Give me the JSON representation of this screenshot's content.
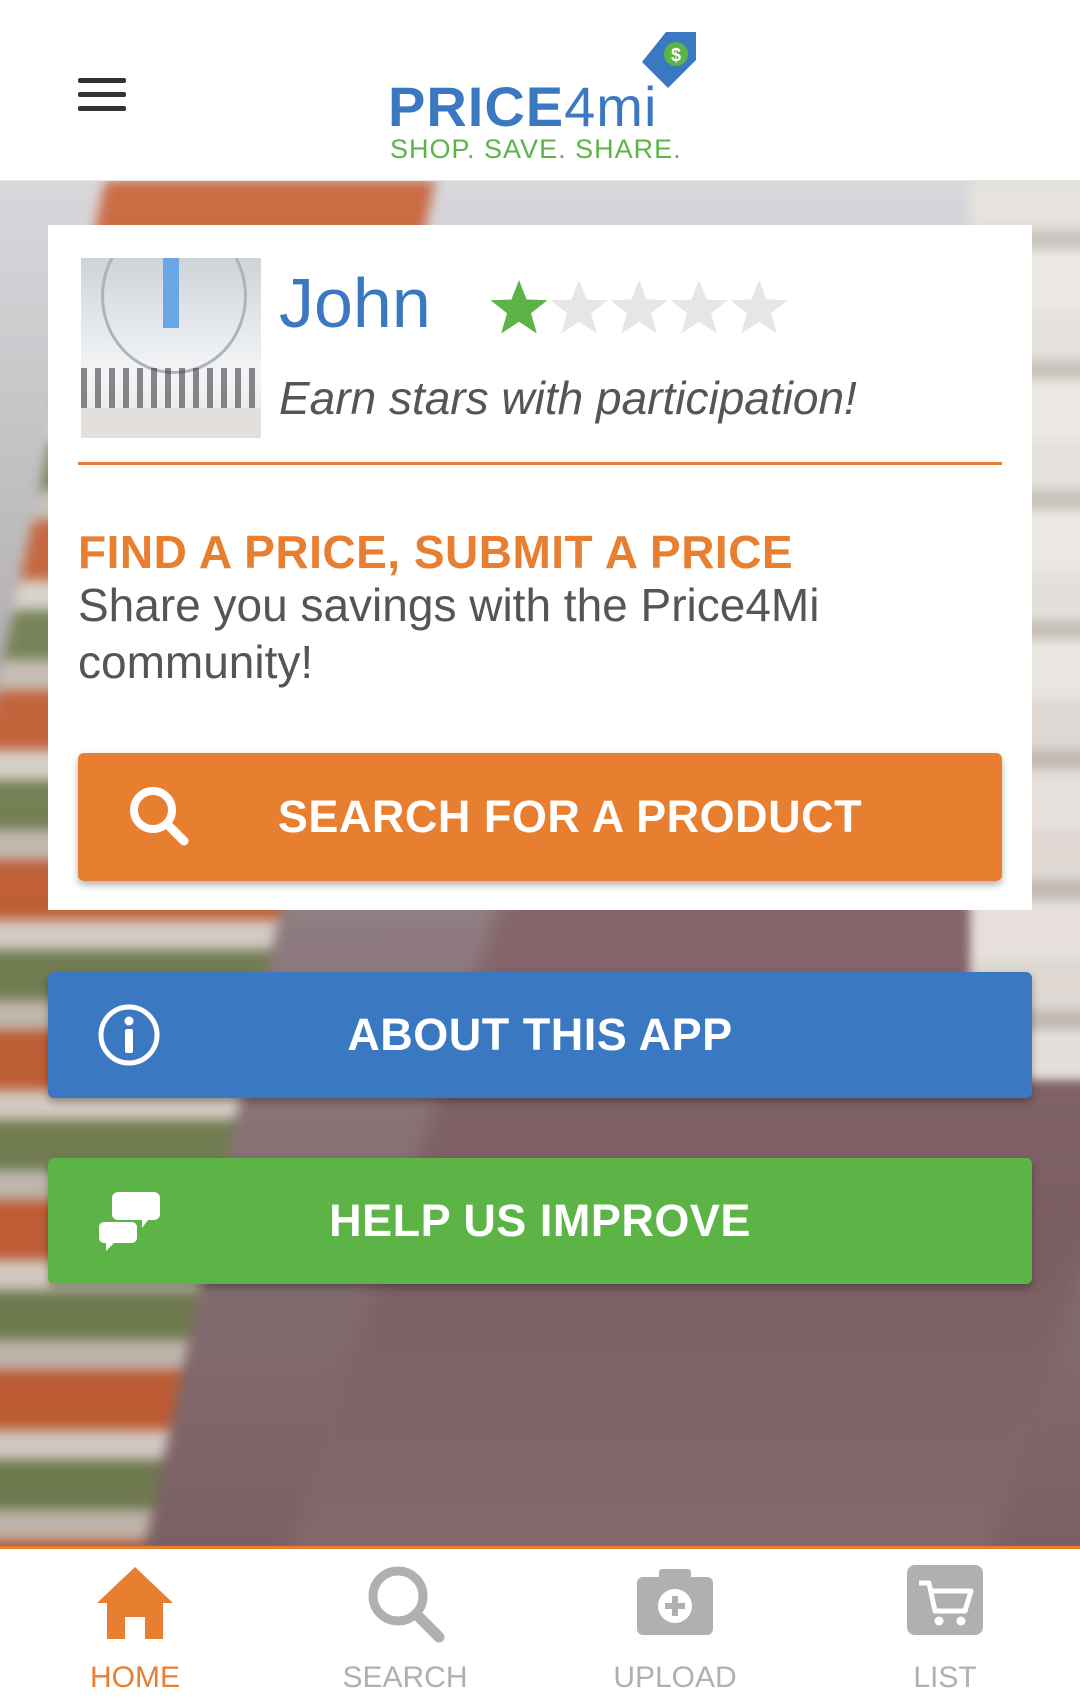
{
  "header": {
    "logo_word_bold": "PRICE",
    "logo_word_thin": "4mi",
    "logo_tagline": "SHOP. SAVE. SHARE.",
    "logo_badge_symbol": "$"
  },
  "profile": {
    "name": "John",
    "rating": 1,
    "rating_max": 5,
    "tagline": "Earn stars with participation!"
  },
  "promo": {
    "headline": "FIND A PRICE, SUBMIT A PRICE",
    "subtext": "Share you savings with the Price4Mi community!"
  },
  "buttons": {
    "search": {
      "label": "SEARCH FOR A PRODUCT",
      "icon": "search-icon"
    },
    "about": {
      "label": "ABOUT THIS APP",
      "icon": "info-icon"
    },
    "help": {
      "label": "HELP US IMPROVE",
      "icon": "chat-bubbles-icon"
    }
  },
  "bottom_nav": [
    {
      "label": "HOME",
      "icon": "home-icon",
      "active": true
    },
    {
      "label": "SEARCH",
      "icon": "search-icon",
      "active": false
    },
    {
      "label": "UPLOAD",
      "icon": "camera-plus-icon",
      "active": false
    },
    {
      "label": "LIST",
      "icon": "cart-icon",
      "active": false
    }
  ],
  "colors": {
    "brand_blue": "#3b78c2",
    "brand_green": "#5cb446",
    "brand_orange": "#e87e30",
    "star_empty": "#e6e6e6",
    "nav_inactive": "#b0b0b0"
  }
}
